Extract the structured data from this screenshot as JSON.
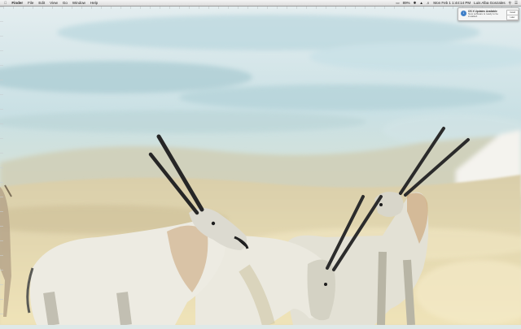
{
  "menubar": {
    "apple_icon": "apple-icon",
    "app_name": "Finder",
    "menus": [
      "File",
      "Edit",
      "View",
      "Go",
      "Window",
      "Help"
    ],
    "status": {
      "battery": "89%",
      "clock": "Mon Feb 1  1:44:14 PM",
      "user": "Luis Alba Gonzales"
    }
  },
  "notification": {
    "title": "OS X Updates Available",
    "body": "New software is ready to be installed.",
    "button_primary": "Install",
    "button_secondary": "Later"
  },
  "colors": {
    "sky": "#cfe4e8",
    "sand": "#e9dcb0",
    "oryx_body": "#e8e6dc",
    "horn": "#2a2a2a"
  }
}
